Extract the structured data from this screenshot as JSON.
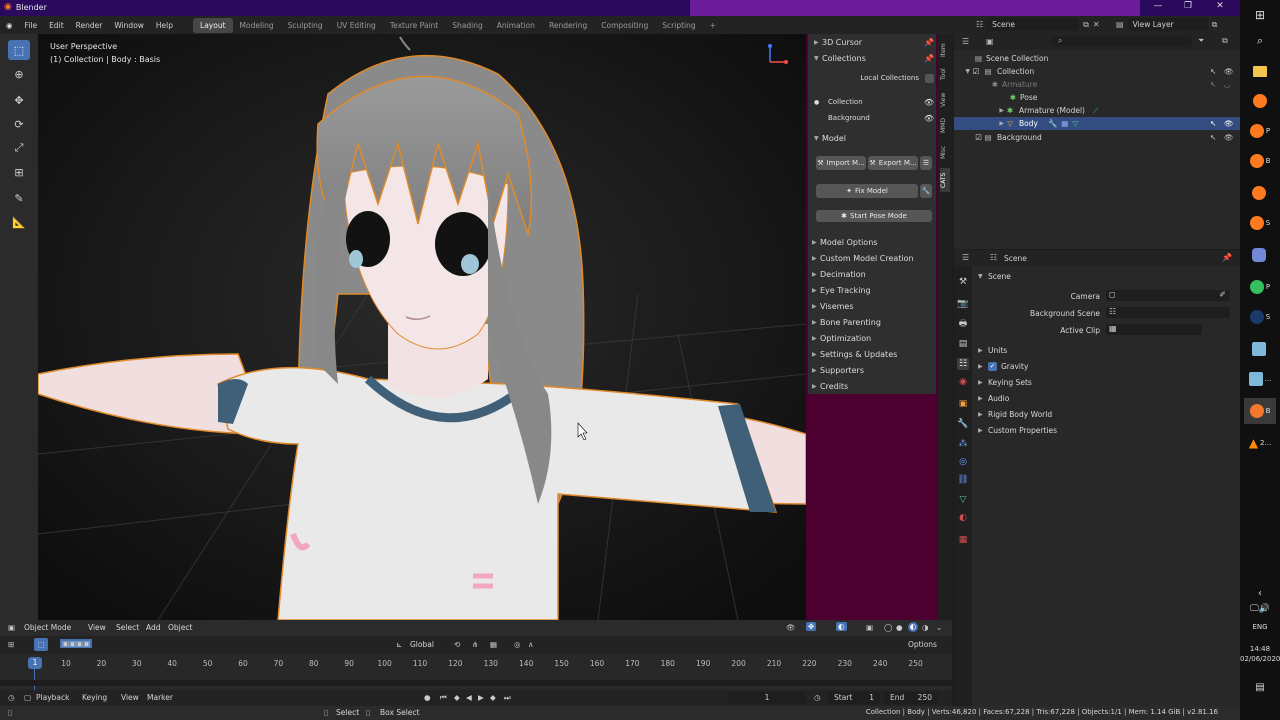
{
  "window": {
    "title": "Blender",
    "controls": [
      "—",
      "❐",
      "✕"
    ]
  },
  "menu": [
    "File",
    "Edit",
    "Render",
    "Window",
    "Help"
  ],
  "workspaces": [
    "Layout",
    "Modeling",
    "Sculpting",
    "UV Editing",
    "Texture Paint",
    "Shading",
    "Animation",
    "Rendering",
    "Compositing",
    "Scripting",
    "+"
  ],
  "scene": {
    "name": "Scene",
    "view_layer": "View Layer"
  },
  "viewport": {
    "perspective": "User Perspective",
    "context": "(1) Collection | Body : Basis"
  },
  "npanel": {
    "cursor": "3D Cursor",
    "collections": "Collections",
    "local_collections": "Local Collections",
    "collection_items": [
      "Collection",
      "Background"
    ],
    "model": "Model",
    "import": "Import M...",
    "export": "Export M...",
    "fix_model": "Fix Model",
    "start_pose": "Start Pose Mode",
    "sections": [
      "Model Options",
      "Custom Model Creation",
      "Decimation",
      "Eye Tracking",
      "Visemes",
      "Bone Parenting",
      "Optimization",
      "Settings & Updates",
      "Supporters",
      "Credits"
    ],
    "tabs": [
      "Item",
      "Tool",
      "View",
      "MMD",
      "Misc",
      "CATS"
    ]
  },
  "outliner": {
    "root": "Scene Collection",
    "items": [
      {
        "label": "Collection"
      },
      {
        "label": "Armature"
      },
      {
        "label": "Pose"
      },
      {
        "label": "Armature (Model)"
      },
      {
        "label": "Body"
      },
      {
        "label": "Background"
      }
    ]
  },
  "properties": {
    "breadcrumb": "Scene",
    "panel": "Scene",
    "camera_label": "Camera",
    "bg_scene_label": "Background Scene",
    "active_clip_label": "Active Clip",
    "sections": [
      "Units",
      "Gravity",
      "Keying Sets",
      "Audio",
      "Rigid Body World",
      "Custom Properties"
    ],
    "gravity_checked": true
  },
  "viewport_header": {
    "mode": "Object Mode",
    "menus": [
      "View",
      "Select",
      "Add",
      "Object"
    ],
    "orientation": "Global",
    "options": "Options"
  },
  "timeline": {
    "ticks": [
      "10",
      "20",
      "30",
      "40",
      "50",
      "60",
      "70",
      "80",
      "90",
      "100",
      "110",
      "120",
      "130",
      "140",
      "150",
      "160",
      "170",
      "180",
      "190",
      "200",
      "210",
      "220",
      "230",
      "240",
      "250"
    ],
    "current_frame": "1",
    "menus": [
      "Playback",
      "Keying",
      "View",
      "Marker"
    ],
    "frame_field": "1",
    "start_label": "Start",
    "start": "1",
    "end_label": "End",
    "end": "250"
  },
  "status": {
    "select": "Select",
    "box_select": "Box Select",
    "stats": "Collection | Body | Verts:46,820 | Faces:67,228 | Tris:67,228 | Objects:1/1 | Mem: 1.14 GiB | v2.81.16"
  },
  "taskbar": {
    "apps": [
      "P",
      "B",
      "",
      "S",
      "",
      "P",
      "S",
      "",
      "...",
      "B",
      "2..."
    ],
    "lang": "ENG",
    "time": "14:48",
    "date": "02/06/2020"
  },
  "colors": {
    "accent": "#4772b3",
    "selection": "#334d80",
    "npanel_bg": "#4b0030",
    "titlebar": "#2b0a5e",
    "model_outline": "#e08a2a"
  }
}
